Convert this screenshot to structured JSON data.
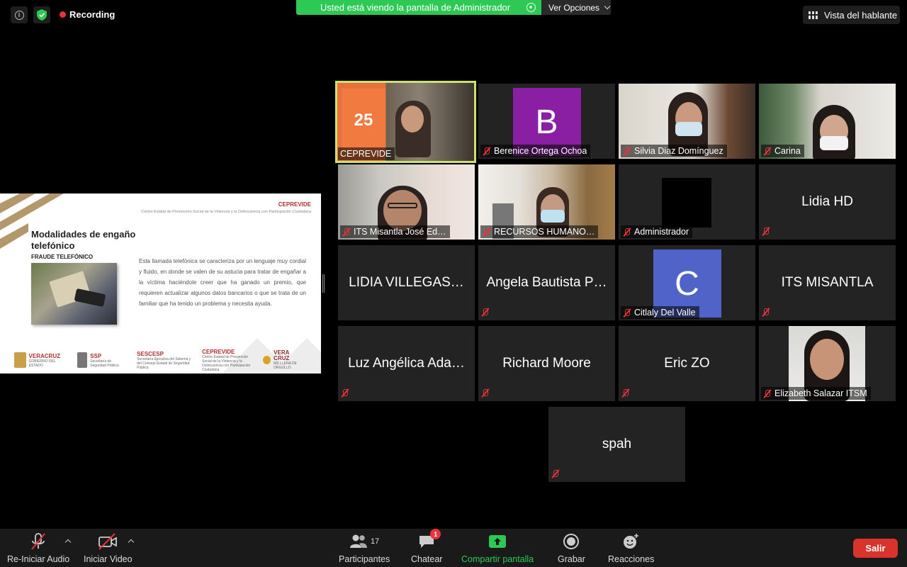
{
  "top": {
    "recording_label": "Recording",
    "share_banner": "Usted está viendo la pantalla de Administrador",
    "view_options": "Ver Opciones",
    "speaker_view": "Vista del hablante"
  },
  "slide": {
    "org": "CEPREVIDE",
    "org_full": "Centro Estatal de Prevención Social de la Violencia y la Delincuencia con Participación Ciudadana",
    "title": "Modalidades de engaño telefónico",
    "subtitle": "FRAUDE TELEFÓNICO",
    "body": "Esta llamada telefónica se caracteriza por un lenguaje muy cordial y fluido, en donde se valen de su astucia para tratar de engañar a la víctima haciéndole creer que ha ganado un premio, que requieren actualizar algunos datos bancarios o que se trata de un familiar que ha tenido un problema y necesita ayuda.",
    "logos": {
      "veracruz_1": "VERACRUZ",
      "veracruz_2": "GOBIERNO DEL ESTADO",
      "ssp_1": "SSP",
      "ssp_2": "Secretaría de Seguridad Pública",
      "sescesp_1": "SESCESP",
      "sescesp_2": "Secretaría Ejecutiva del Sistema y del Consejo Estatal de Seguridad Pública",
      "ceprevide_1": "CEPREVIDE",
      "ceprevide_2": "Centro Estatal de Prevención Social de la Violencia y la Delincuencia con Participación Ciudadana",
      "vera_1": "VERA",
      "vera_2": "CRUZ",
      "vera_3": "ME LLENA DE ORGULLO"
    }
  },
  "participants": {
    "p1": "CEPREVIDE",
    "p2": "Berenice Ortega Ochoa",
    "p2_initial": "B",
    "p3": "Silvia Diaz Domínguez",
    "p4": "Carina",
    "p5": "ITS Misantla José Ed…",
    "p6": "RECURSOS HUMANO…",
    "p7": "Administrador",
    "p8": "Lidia HD",
    "p9": "LIDIA VILLEGAS…",
    "p10": "Angela Bautista P…",
    "p11": "Citlaly Del Valle",
    "p11_initial": "C",
    "p12": "ITS MISANTLA",
    "p13": "Luz Angélica Ada…",
    "p14": "Richard Moore",
    "p15": "Eric ZO",
    "p16": "Elizabeth Salazar ITSM",
    "p17": "spah"
  },
  "colors": {
    "active_border": "#cde06b",
    "avatar_b": "#8a1fa3",
    "avatar_c": "#5063c8",
    "accent_green": "#2ec954",
    "muted_red": "#e8333b",
    "leave_red": "#d9342b"
  },
  "toolbar": {
    "audio": "Re-Iniciar Audio",
    "video": "Iniciar Video",
    "participants": "Participantes",
    "participants_count": "17",
    "chat": "Chatear",
    "chat_badge": "1",
    "share": "Compartir pantalla",
    "record": "Grabar",
    "reactions": "Reacciones",
    "leave": "Salir"
  }
}
